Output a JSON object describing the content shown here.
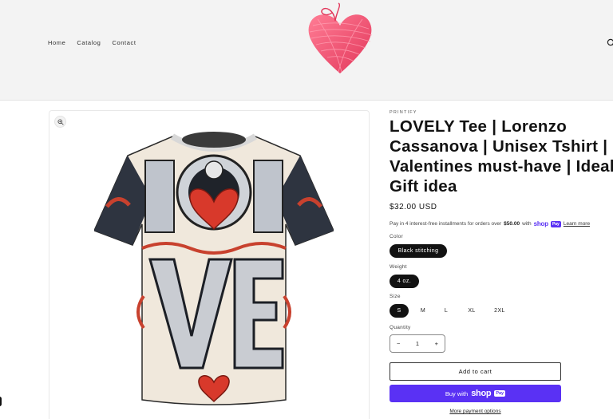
{
  "nav": {
    "items": [
      {
        "label": "Home"
      },
      {
        "label": "Catalog"
      },
      {
        "label": "Contact"
      }
    ]
  },
  "icons": {
    "logo": "yarn-heart-logo",
    "search": "search-icon",
    "zoom": "zoom-in-icon",
    "minus": "minus-icon",
    "plus": "plus-icon"
  },
  "product": {
    "vendor": "PRINTIFY",
    "title": "LOVELY Tee | Lorenzo Cassanova | Unisex Tshirt | Valentines must-have | Ideal Gift idea",
    "price": "$32.00 USD",
    "installments": {
      "text_before": "Pay in 4 interest-free installments for orders over",
      "threshold": "$50.00",
      "text_with": "with",
      "shop": "shop",
      "pay": "Pay",
      "learn_more": "Learn more"
    },
    "options": {
      "color": {
        "label": "Color",
        "values": [
          "Black stitching"
        ],
        "selected": "Black stitching"
      },
      "weight": {
        "label": "Weight",
        "values": [
          "4 oz."
        ],
        "selected": "4 oz."
      },
      "size": {
        "label": "Size",
        "values": [
          "S",
          "M",
          "L",
          "XL",
          "2XL"
        ],
        "selected": "S"
      }
    },
    "quantity": {
      "label": "Quantity",
      "value": "1",
      "minus": "−",
      "plus": "+"
    }
  },
  "buttons": {
    "add_to_cart": "Add to cart",
    "buy_with": "Buy with",
    "shop": "shop",
    "pay": "Pay",
    "more_payment": "More payment options"
  },
  "colors": {
    "accent": "#5a31f4",
    "selected_pill": "#121212",
    "header_bg": "#f3f3f3",
    "heart": "#f0506e"
  }
}
